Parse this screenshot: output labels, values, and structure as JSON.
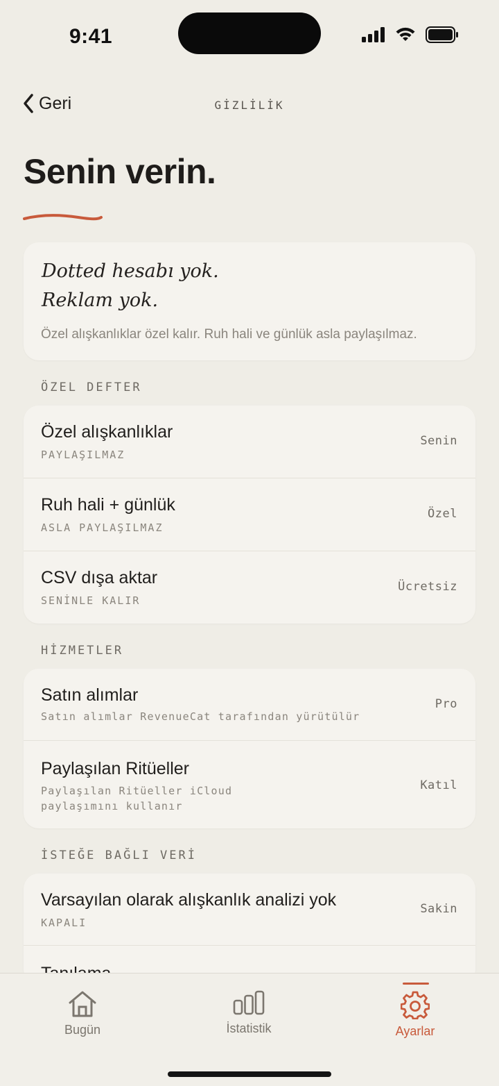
{
  "status_bar": {
    "time": "9:41"
  },
  "nav": {
    "back_label": "Geri",
    "title": "GİZLİLİK"
  },
  "page": {
    "title": "Senin verin."
  },
  "intro": {
    "line1": "Dotted hesabı yok.",
    "line2": "Reklam yok.",
    "description": "Özel alışkanlıklar özel kalır. Ruh hali ve günlük asla paylaşılmaz."
  },
  "sections": {
    "private": {
      "label": "ÖZEL DEFTER",
      "rows": [
        {
          "title": "Özel alışkanlıklar",
          "subtitle": "PAYLAŞILMAZ",
          "value": "Senin"
        },
        {
          "title": "Ruh hali + günlük",
          "subtitle": "ASLA PAYLAŞILMAZ",
          "value": "Özel"
        },
        {
          "title": "CSV dışa aktar",
          "subtitle": "SENİNLE KALIR",
          "value": "Ücretsiz"
        }
      ]
    },
    "services": {
      "label": "HİZMETLER",
      "rows": [
        {
          "title": "Satın alımlar",
          "subtitle": "Satın alımlar RevenueCat tarafından yürütülür",
          "value": "Pro"
        },
        {
          "title": "Paylaşılan Ritüeller",
          "subtitle_line1": "Paylaşılan Ritüeller iCloud",
          "subtitle_line2": "paylaşımını kullanır",
          "value": "Katıl"
        }
      ]
    },
    "optional": {
      "label": "İSTEĞE BAĞLI VERİ",
      "rows": [
        {
          "title": "Varsayılan olarak alışkanlık analizi yok",
          "subtitle": "KAPALI",
          "value": "Sakin"
        },
        {
          "title": "Tanılama"
        }
      ]
    }
  },
  "tab_bar": {
    "tabs": [
      {
        "label": "Bugün",
        "icon": "home-icon"
      },
      {
        "label": "İstatistik",
        "icon": "bar-chart-icon"
      },
      {
        "label": "Ayarlar",
        "icon": "gear-icon",
        "active": true
      }
    ]
  },
  "colors": {
    "accent": "#c85a3b",
    "background": "#efede6",
    "card": "#f5f3ee"
  }
}
